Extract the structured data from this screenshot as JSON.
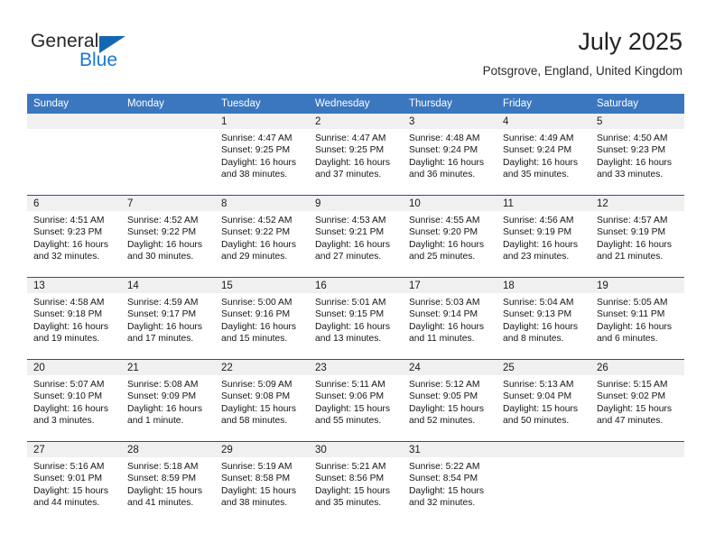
{
  "brand": {
    "name_top": "General",
    "name_bottom": "Blue",
    "triangle_color": "#1567b2",
    "blue_text_color": "#1779cf"
  },
  "header": {
    "title": "July 2025",
    "subtitle": "Potsgrove, England, United Kingdom"
  },
  "theme": {
    "header_blue": "#3b77bf",
    "row_divider": "#1f5596",
    "daynum_band": "#f0f0f0",
    "page_background": "#ffffff"
  },
  "weekdays": [
    "Sunday",
    "Monday",
    "Tuesday",
    "Wednesday",
    "Thursday",
    "Friday",
    "Saturday"
  ],
  "weeks": [
    [
      {
        "day": "",
        "empty": true
      },
      {
        "day": "",
        "empty": true
      },
      {
        "day": "1",
        "sunrise": "Sunrise: 4:47 AM",
        "sunset": "Sunset: 9:25 PM",
        "daylight_1": "Daylight: 16 hours",
        "daylight_2": "and 38 minutes."
      },
      {
        "day": "2",
        "sunrise": "Sunrise: 4:47 AM",
        "sunset": "Sunset: 9:25 PM",
        "daylight_1": "Daylight: 16 hours",
        "daylight_2": "and 37 minutes."
      },
      {
        "day": "3",
        "sunrise": "Sunrise: 4:48 AM",
        "sunset": "Sunset: 9:24 PM",
        "daylight_1": "Daylight: 16 hours",
        "daylight_2": "and 36 minutes."
      },
      {
        "day": "4",
        "sunrise": "Sunrise: 4:49 AM",
        "sunset": "Sunset: 9:24 PM",
        "daylight_1": "Daylight: 16 hours",
        "daylight_2": "and 35 minutes."
      },
      {
        "day": "5",
        "sunrise": "Sunrise: 4:50 AM",
        "sunset": "Sunset: 9:23 PM",
        "daylight_1": "Daylight: 16 hours",
        "daylight_2": "and 33 minutes."
      }
    ],
    [
      {
        "day": "6",
        "sunrise": "Sunrise: 4:51 AM",
        "sunset": "Sunset: 9:23 PM",
        "daylight_1": "Daylight: 16 hours",
        "daylight_2": "and 32 minutes."
      },
      {
        "day": "7",
        "sunrise": "Sunrise: 4:52 AM",
        "sunset": "Sunset: 9:22 PM",
        "daylight_1": "Daylight: 16 hours",
        "daylight_2": "and 30 minutes."
      },
      {
        "day": "8",
        "sunrise": "Sunrise: 4:52 AM",
        "sunset": "Sunset: 9:22 PM",
        "daylight_1": "Daylight: 16 hours",
        "daylight_2": "and 29 minutes."
      },
      {
        "day": "9",
        "sunrise": "Sunrise: 4:53 AM",
        "sunset": "Sunset: 9:21 PM",
        "daylight_1": "Daylight: 16 hours",
        "daylight_2": "and 27 minutes."
      },
      {
        "day": "10",
        "sunrise": "Sunrise: 4:55 AM",
        "sunset": "Sunset: 9:20 PM",
        "daylight_1": "Daylight: 16 hours",
        "daylight_2": "and 25 minutes."
      },
      {
        "day": "11",
        "sunrise": "Sunrise: 4:56 AM",
        "sunset": "Sunset: 9:19 PM",
        "daylight_1": "Daylight: 16 hours",
        "daylight_2": "and 23 minutes."
      },
      {
        "day": "12",
        "sunrise": "Sunrise: 4:57 AM",
        "sunset": "Sunset: 9:19 PM",
        "daylight_1": "Daylight: 16 hours",
        "daylight_2": "and 21 minutes."
      }
    ],
    [
      {
        "day": "13",
        "sunrise": "Sunrise: 4:58 AM",
        "sunset": "Sunset: 9:18 PM",
        "daylight_1": "Daylight: 16 hours",
        "daylight_2": "and 19 minutes."
      },
      {
        "day": "14",
        "sunrise": "Sunrise: 4:59 AM",
        "sunset": "Sunset: 9:17 PM",
        "daylight_1": "Daylight: 16 hours",
        "daylight_2": "and 17 minutes."
      },
      {
        "day": "15",
        "sunrise": "Sunrise: 5:00 AM",
        "sunset": "Sunset: 9:16 PM",
        "daylight_1": "Daylight: 16 hours",
        "daylight_2": "and 15 minutes."
      },
      {
        "day": "16",
        "sunrise": "Sunrise: 5:01 AM",
        "sunset": "Sunset: 9:15 PM",
        "daylight_1": "Daylight: 16 hours",
        "daylight_2": "and 13 minutes."
      },
      {
        "day": "17",
        "sunrise": "Sunrise: 5:03 AM",
        "sunset": "Sunset: 9:14 PM",
        "daylight_1": "Daylight: 16 hours",
        "daylight_2": "and 11 minutes."
      },
      {
        "day": "18",
        "sunrise": "Sunrise: 5:04 AM",
        "sunset": "Sunset: 9:13 PM",
        "daylight_1": "Daylight: 16 hours",
        "daylight_2": "and 8 minutes."
      },
      {
        "day": "19",
        "sunrise": "Sunrise: 5:05 AM",
        "sunset": "Sunset: 9:11 PM",
        "daylight_1": "Daylight: 16 hours",
        "daylight_2": "and 6 minutes."
      }
    ],
    [
      {
        "day": "20",
        "sunrise": "Sunrise: 5:07 AM",
        "sunset": "Sunset: 9:10 PM",
        "daylight_1": "Daylight: 16 hours",
        "daylight_2": "and 3 minutes."
      },
      {
        "day": "21",
        "sunrise": "Sunrise: 5:08 AM",
        "sunset": "Sunset: 9:09 PM",
        "daylight_1": "Daylight: 16 hours",
        "daylight_2": "and 1 minute."
      },
      {
        "day": "22",
        "sunrise": "Sunrise: 5:09 AM",
        "sunset": "Sunset: 9:08 PM",
        "daylight_1": "Daylight: 15 hours",
        "daylight_2": "and 58 minutes."
      },
      {
        "day": "23",
        "sunrise": "Sunrise: 5:11 AM",
        "sunset": "Sunset: 9:06 PM",
        "daylight_1": "Daylight: 15 hours",
        "daylight_2": "and 55 minutes."
      },
      {
        "day": "24",
        "sunrise": "Sunrise: 5:12 AM",
        "sunset": "Sunset: 9:05 PM",
        "daylight_1": "Daylight: 15 hours",
        "daylight_2": "and 52 minutes."
      },
      {
        "day": "25",
        "sunrise": "Sunrise: 5:13 AM",
        "sunset": "Sunset: 9:04 PM",
        "daylight_1": "Daylight: 15 hours",
        "daylight_2": "and 50 minutes."
      },
      {
        "day": "26",
        "sunrise": "Sunrise: 5:15 AM",
        "sunset": "Sunset: 9:02 PM",
        "daylight_1": "Daylight: 15 hours",
        "daylight_2": "and 47 minutes."
      }
    ],
    [
      {
        "day": "27",
        "sunrise": "Sunrise: 5:16 AM",
        "sunset": "Sunset: 9:01 PM",
        "daylight_1": "Daylight: 15 hours",
        "daylight_2": "and 44 minutes."
      },
      {
        "day": "28",
        "sunrise": "Sunrise: 5:18 AM",
        "sunset": "Sunset: 8:59 PM",
        "daylight_1": "Daylight: 15 hours",
        "daylight_2": "and 41 minutes."
      },
      {
        "day": "29",
        "sunrise": "Sunrise: 5:19 AM",
        "sunset": "Sunset: 8:58 PM",
        "daylight_1": "Daylight: 15 hours",
        "daylight_2": "and 38 minutes."
      },
      {
        "day": "30",
        "sunrise": "Sunrise: 5:21 AM",
        "sunset": "Sunset: 8:56 PM",
        "daylight_1": "Daylight: 15 hours",
        "daylight_2": "and 35 minutes."
      },
      {
        "day": "31",
        "sunrise": "Sunrise: 5:22 AM",
        "sunset": "Sunset: 8:54 PM",
        "daylight_1": "Daylight: 15 hours",
        "daylight_2": "and 32 minutes."
      },
      {
        "day": "",
        "empty": true
      },
      {
        "day": "",
        "empty": true
      }
    ]
  ]
}
